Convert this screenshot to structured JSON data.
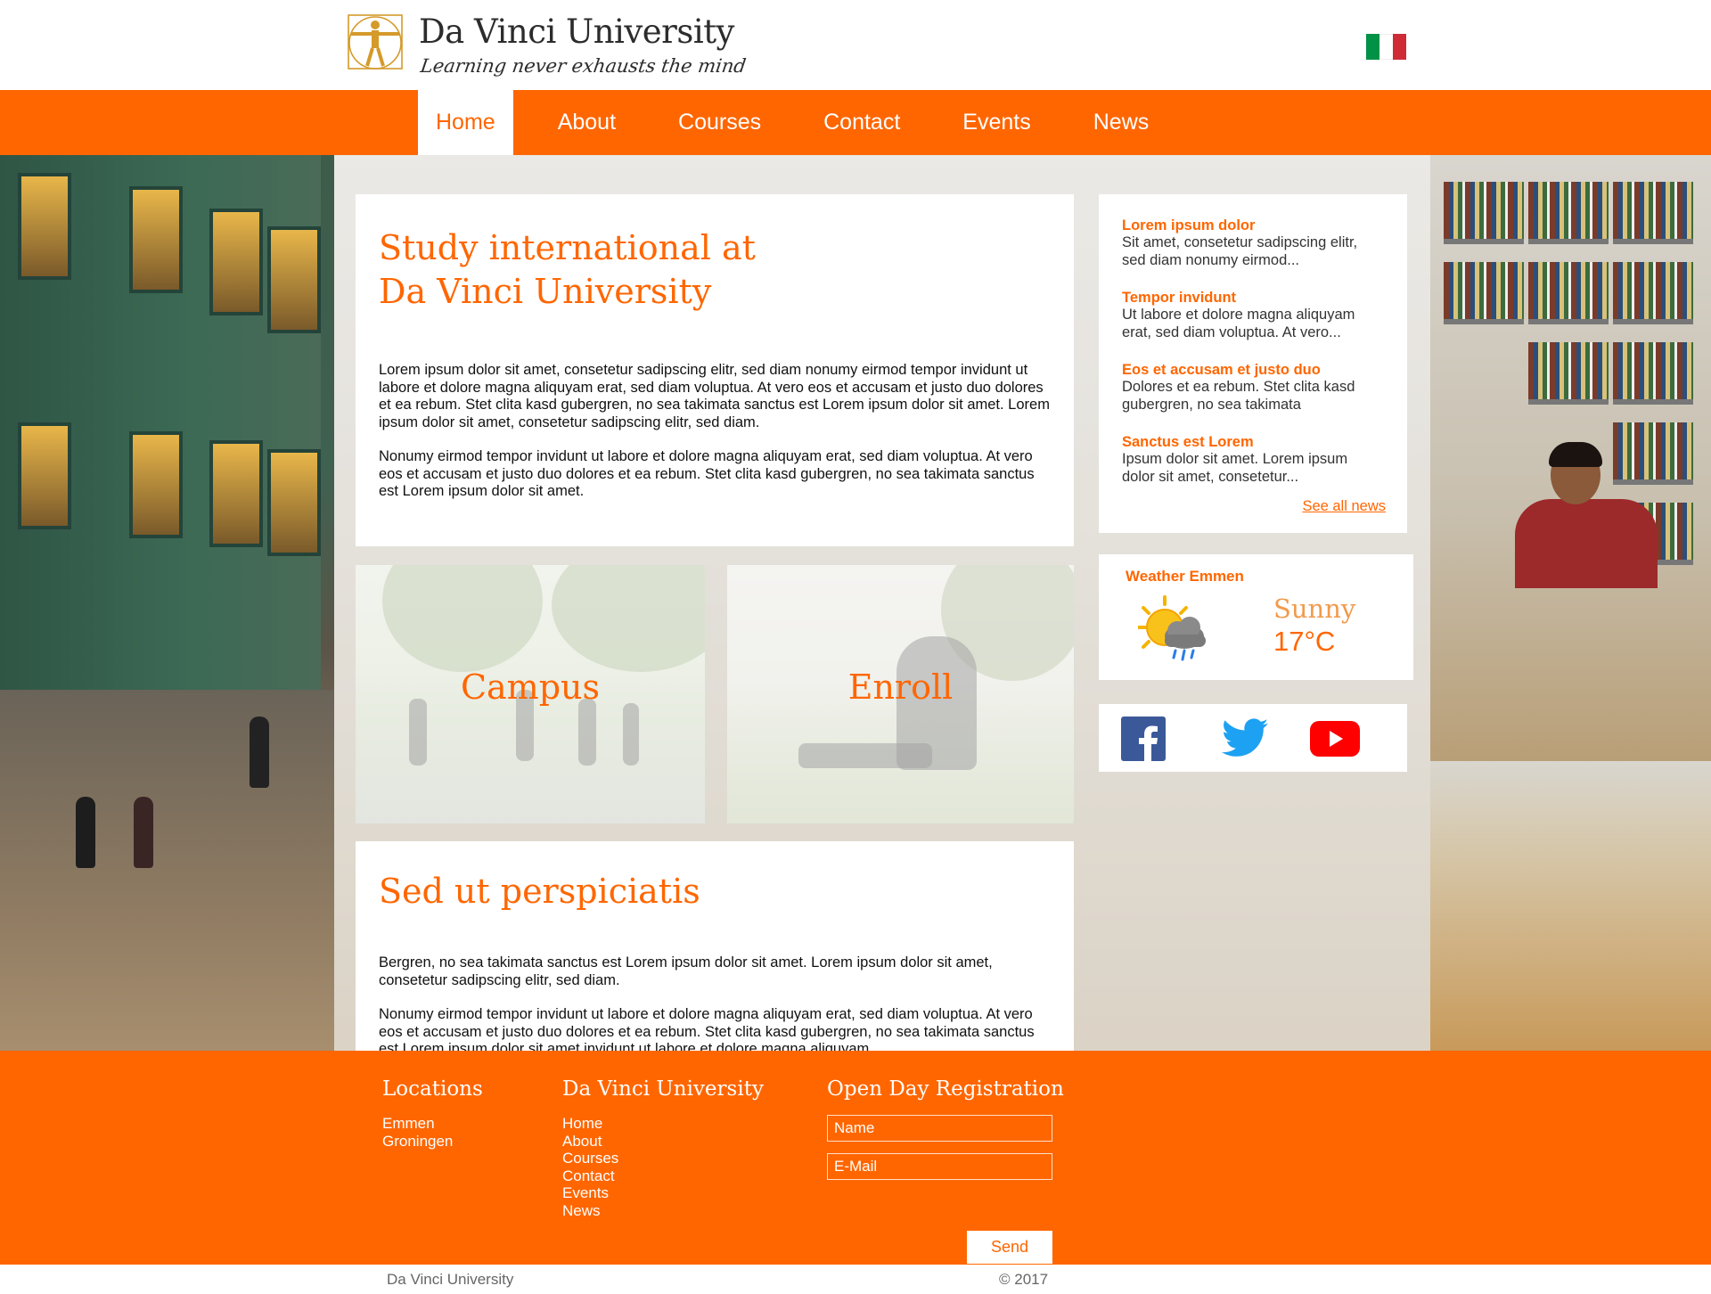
{
  "header": {
    "title": "Da Vinci University",
    "tagline": "Learning never exhausts the mind",
    "flag_colors": [
      "#009246",
      "#ffffff",
      "#ce2b37"
    ]
  },
  "nav": {
    "items": [
      {
        "label": "Home",
        "active": true
      },
      {
        "label": "About"
      },
      {
        "label": "Courses"
      },
      {
        "label": "Contact"
      },
      {
        "label": "Events"
      },
      {
        "label": "News"
      }
    ]
  },
  "intro": {
    "title_line1": "Study international at",
    "title_line2": "Da Vinci University",
    "paragraph1": "Lorem ipsum dolor sit amet, consetetur sadipscing elitr, sed diam nonumy eirmod tempor invidunt ut labore et dolore magna aliquyam erat, sed diam voluptua. At vero eos et accusam et justo duo dolores et ea rebum. Stet clita kasd gubergren, no sea takimata sanctus est Lorem ipsum dolor sit amet. Lorem ipsum dolor sit amet, consetetur sadipscing elitr, sed diam.",
    "paragraph2": "Nonumy eirmod tempor invidunt ut labore et dolore magna aliquyam erat, sed diam voluptua. At vero eos et accusam et justo duo dolores et ea rebum. Stet clita kasd gubergren, no sea takimata sanctus est Lorem ipsum dolor sit amet."
  },
  "tiles": {
    "campus": "Campus",
    "enroll": "Enroll"
  },
  "second": {
    "title": "Sed ut perspiciatis",
    "paragraph1": "Bergren, no sea takimata sanctus est Lorem ipsum dolor sit amet. Lorem ipsum dolor sit amet, consetetur sadipscing elitr, sed diam.",
    "paragraph2": "Nonumy eirmod tempor invidunt ut labore et dolore magna aliquyam erat, sed diam voluptua. At vero eos et accusam et justo duo dolores et ea rebum. Stet clita kasd gubergren, no sea takimata sanctus est Lorem ipsum dolor sit amet invidunt ut labore et dolore magna aliquyam"
  },
  "news": {
    "items": [
      {
        "title": "Lorem ipsum dolor",
        "text": "Sit amet, consetetur sadipscing elitr, sed diam nonumy eirmod..."
      },
      {
        "title": "Tempor invidunt",
        "text": "Ut labore et dolore magna aliquyam erat, sed diam voluptua. At vero..."
      },
      {
        "title": "Eos et accusam et justo duo",
        "text": "Dolores et ea rebum. Stet clita kasd gubergren, no sea takimata"
      },
      {
        "title": "Sanctus est Lorem",
        "text": "Ipsum dolor sit amet. Lorem ipsum dolor sit amet, consetetur..."
      }
    ],
    "see_all": "See all news"
  },
  "weather": {
    "title": "Weather Emmen",
    "condition": "Sunny",
    "temperature": "17°C",
    "icon": "sun-cloud-rain-icon"
  },
  "social": {
    "icons": [
      "facebook-icon",
      "twitter-icon",
      "youtube-icon"
    ],
    "colors": {
      "facebook": "#3b5998",
      "twitter": "#1da1f2",
      "youtube": "#ff0000"
    }
  },
  "footer": {
    "locations_title": "Locations",
    "locations": [
      "Emmen",
      "Groningen"
    ],
    "university_title": "Da Vinci University",
    "links": [
      "Home",
      "About",
      "Courses",
      "Contact",
      "Events",
      "News"
    ],
    "registration_title": "Open Day Registration",
    "name_placeholder": "Name",
    "email_placeholder": "E-Mail",
    "send_label": "Send"
  },
  "bottom": {
    "left": "Da Vinci University",
    "right": "© 2017"
  },
  "colors": {
    "accent": "#ff6600",
    "text": "#222222"
  }
}
